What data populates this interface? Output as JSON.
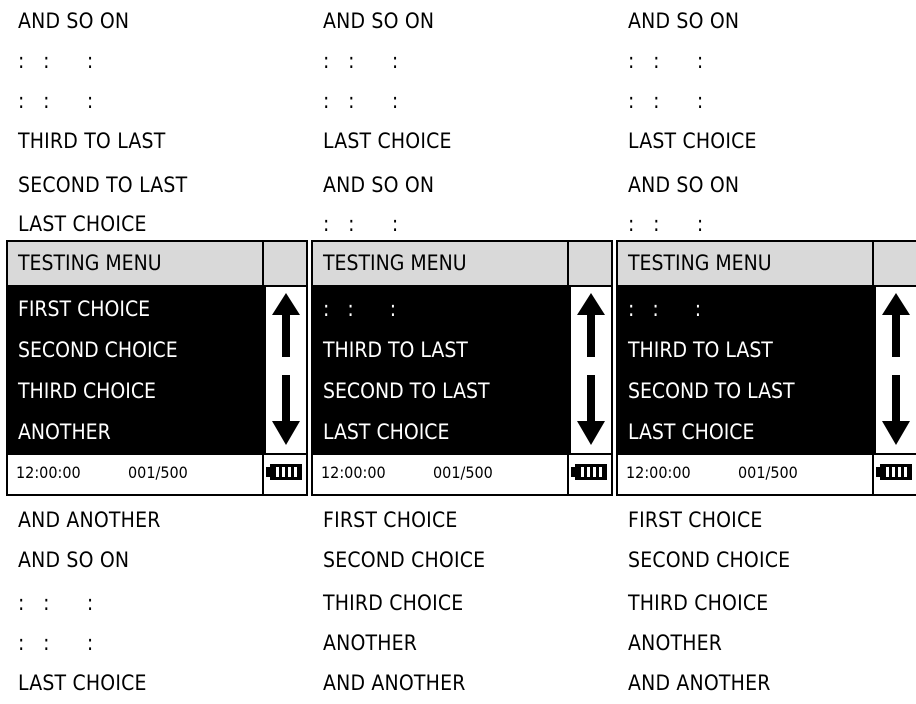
{
  "columns": [
    {
      "above": [
        "AND SO ON",
        ":   :      :",
        ":   :      :",
        "THIRD TO LAST",
        "SECOND TO LAST",
        "LAST CHOICE"
      ],
      "menu": {
        "title": "TESTING MENU",
        "items": [
          "FIRST CHOICE",
          "SECOND CHOICE",
          "THIRD CHOICE",
          "ANOTHER"
        ],
        "time": "12:00:00",
        "count": "001/500"
      },
      "below": [
        "AND ANOTHER",
        "AND SO ON",
        ":   :      :",
        ":   :      :",
        "LAST CHOICE"
      ]
    },
    {
      "above": [
        "AND SO ON",
        ":   :      :",
        ":   :      :",
        "LAST CHOICE",
        "AND SO ON",
        ":   :      :"
      ],
      "menu": {
        "title": "TESTING MENU",
        "items": [
          ":   :      :",
          "THIRD TO LAST",
          "SECOND TO LAST",
          "LAST CHOICE"
        ],
        "time": "12:00:00",
        "count": "001/500"
      },
      "below": [
        "FIRST CHOICE",
        "SECOND CHOICE",
        "THIRD CHOICE",
        "ANOTHER",
        "AND ANOTHER"
      ]
    },
    {
      "above": [
        "AND SO ON",
        ":   :      :",
        ":   :      :",
        "LAST CHOICE",
        "AND SO ON",
        ":   :      :"
      ],
      "menu": {
        "title": "TESTING MENU",
        "items": [
          ":   :      :",
          "THIRD TO LAST",
          "SECOND TO LAST",
          "LAST CHOICE"
        ],
        "time": "12:00:00",
        "count": "001/500"
      },
      "below": [
        "FIRST CHOICE",
        "SECOND CHOICE",
        "THIRD CHOICE",
        "ANOTHER",
        "AND ANOTHER"
      ]
    }
  ],
  "icons": {
    "scroll_up": "arrow-up-icon",
    "scroll_down": "arrow-down-icon",
    "battery": "battery-full-icon"
  },
  "colors": {
    "header_bg": "#d9d9d9",
    "list_bg": "#000000",
    "list_text": "#ffffff"
  }
}
